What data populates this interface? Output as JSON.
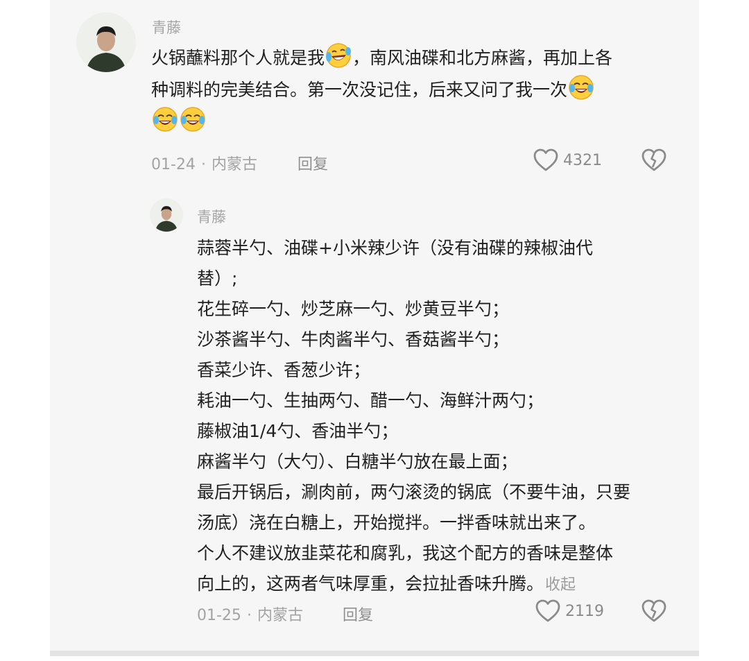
{
  "comment": {
    "author": "青藤",
    "text_lines": [
      "火锅蘸料那个人就是我",
      "，南风油碟和北方麻酱，再加上各",
      "种调料的完美结合。第一次没记住，后来又问了我一次"
    ],
    "emojis": [
      "laughing-tears-emoji",
      "crying-laughing-emoji",
      "crying-laughing-emoji",
      "crying-laughing-emoji"
    ],
    "date": "01-24",
    "separator": "·",
    "location": "内蒙古",
    "reply_label": "回复",
    "like_count": "4321"
  },
  "reply": {
    "author": "青藤",
    "text_lines": [
      "蒜蓉半勺、油碟+小米辣少许（没有油碟的辣椒油代",
      "替）;",
      "花生碎一勺、炒芝麻一勺、炒黄豆半勺；",
      "沙茶酱半勺、牛肉酱半勺、香菇酱半勺；",
      "香菜少许、香葱少许；",
      "耗油一勺、生抽两勺、醋一勺、海鲜汁两勺；",
      "藤椒油1/4勺、香油半勺；",
      "麻酱半勺（大勺）、白糖半勺放在最上面；",
      "最后开锅后，涮肉前，两勺滚烫的锅底（不要牛油，只要",
      "汤底）浇在白糖上，开始搅拌。一拌香味就出来了。",
      "个人不建议放韭菜花和腐乳，我这个配方的香味是整体",
      "向上的，这两者气味厚重，会拉扯香味升腾。"
    ],
    "collapse_label": "收起",
    "date": "01-25",
    "separator": "·",
    "location": "内蒙古",
    "reply_label": "回复",
    "like_count": "2119"
  },
  "icons": {
    "like": "heart-outline-icon",
    "dislike": "broken-heart-icon"
  },
  "colors": {
    "panel_background": "#f6f6f6",
    "text": "#1f1f1f",
    "meta_text": "#a3a3a3",
    "emoji_yellow": "#ffcf3d"
  }
}
